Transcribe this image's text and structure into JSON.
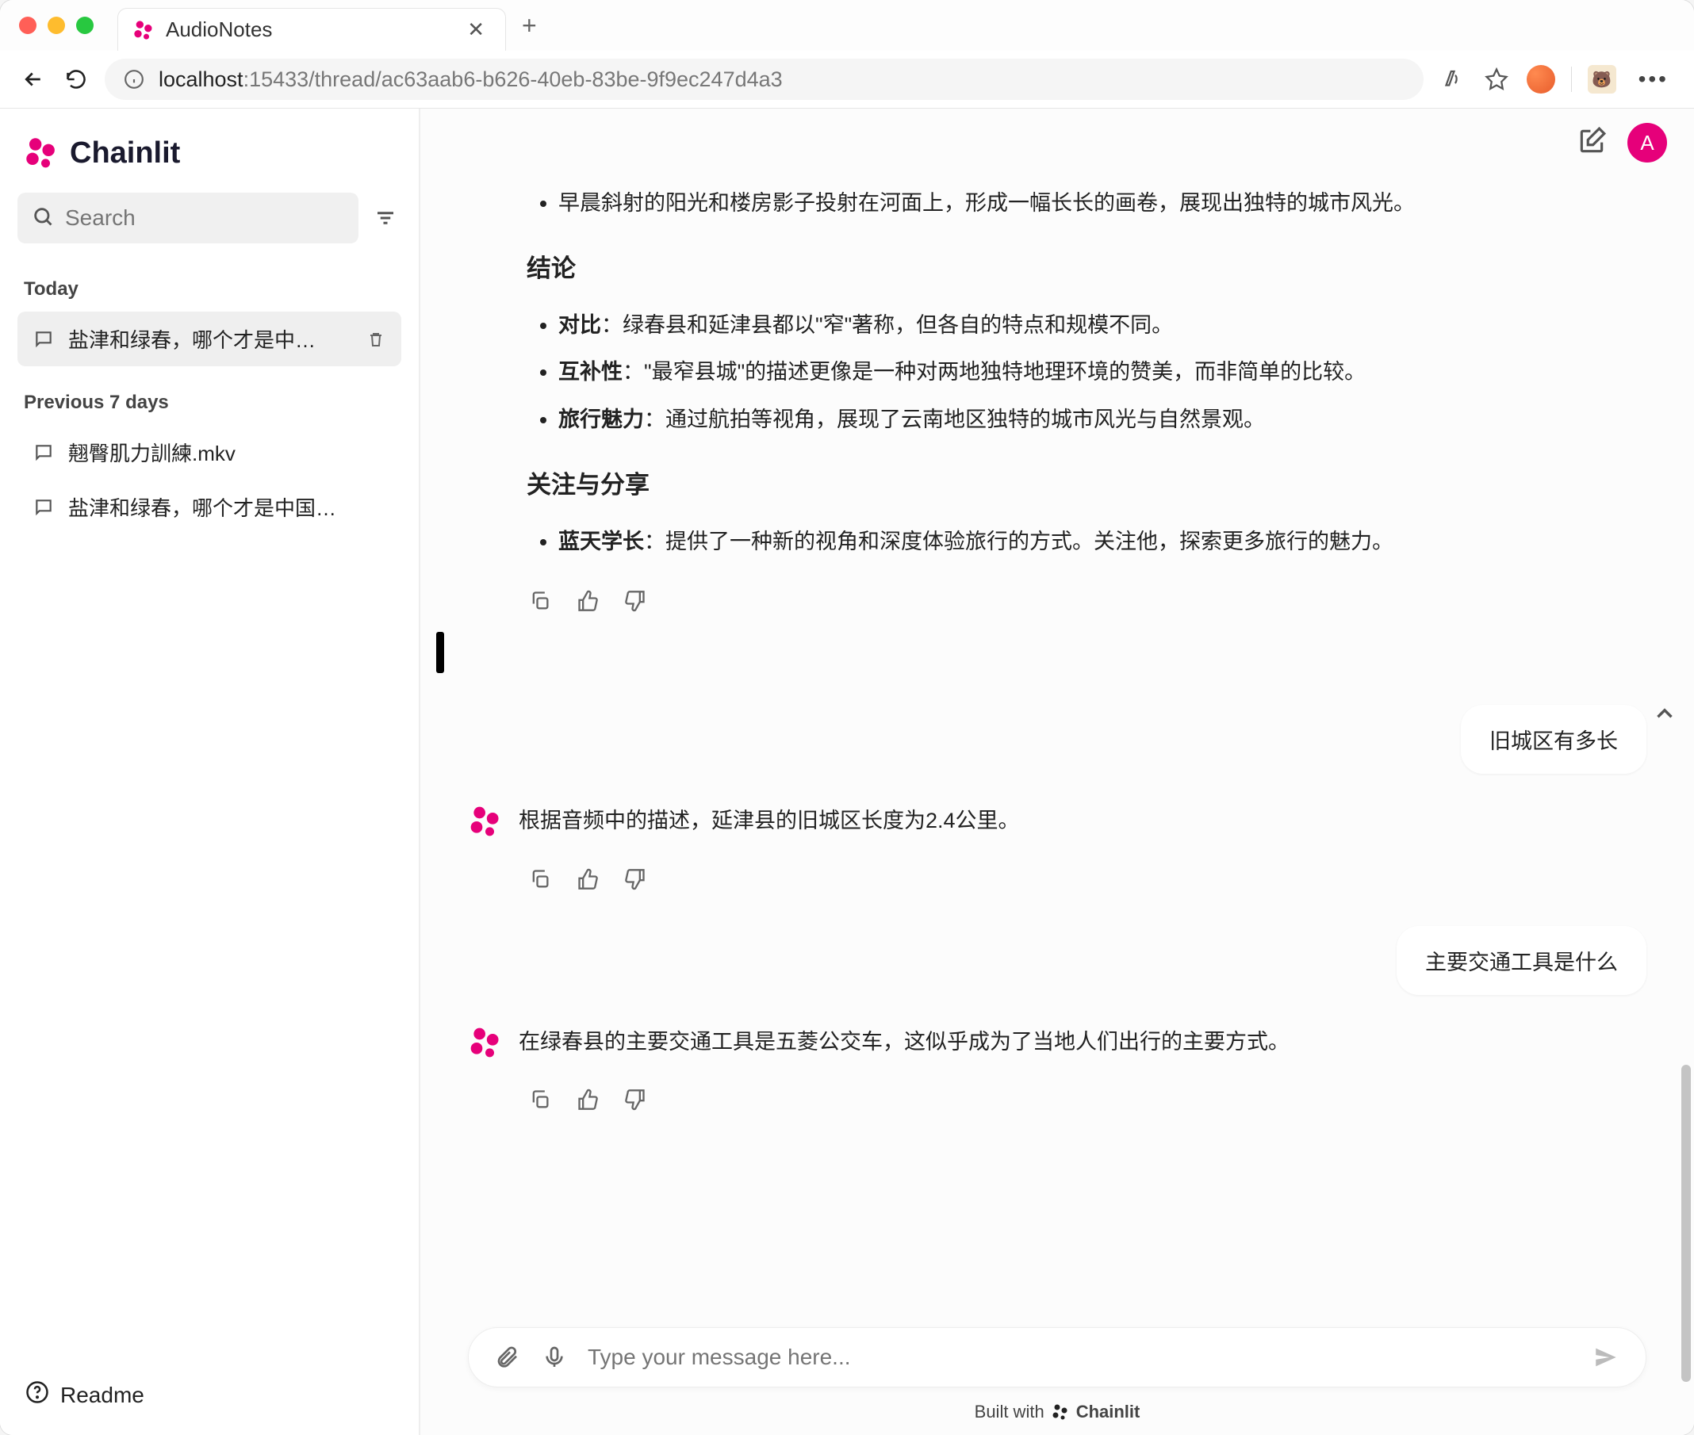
{
  "browser": {
    "tab_title": "AudioNotes",
    "url_host": "localhost",
    "url_path": ":15433/thread/ac63aab6-b626-40eb-83be-9f9ec247d4a3"
  },
  "sidebar": {
    "brand": "Chainlit",
    "search_placeholder": "Search",
    "sections": [
      {
        "label": "Today",
        "items": [
          {
            "title": "盐津和绿春，哪个才是中…",
            "active": true,
            "deletable": true
          }
        ]
      },
      {
        "label": "Previous 7 days",
        "items": [
          {
            "title": "翹臀肌力訓練.mkv",
            "active": false,
            "deletable": false
          },
          {
            "title": "盐津和绿春，哪个才是中国…",
            "active": false,
            "deletable": false
          }
        ]
      }
    ],
    "readme": "Readme"
  },
  "header": {
    "avatar_letter": "A"
  },
  "conversation": {
    "partial_bullet": "早晨斜射的阳光和楼房影子投射在河面上，形成一幅长长的画卷，展现出独特的城市风光。",
    "heading1": "结论",
    "bullets1": [
      {
        "term": "对比",
        "text": "：绿春县和延津县都以\"窄\"著称，但各自的特点和规模不同。"
      },
      {
        "term": "互补性",
        "text": "：\"最窄县城\"的描述更像是一种对两地独特地理环境的赞美，而非简单的比较。"
      },
      {
        "term": "旅行魅力",
        "text": "：通过航拍等视角，展现了云南地区独特的城市风光与自然景观。"
      }
    ],
    "heading2": "关注与分享",
    "bullets2": [
      {
        "term": "蓝天学长",
        "text": "：提供了一种新的视角和深度体验旅行的方式。关注他，探索更多旅行的魅力。"
      }
    ],
    "user1": "旧城区有多长",
    "assistant1": "根据音频中的描述，延津县的旧城区长度为2.4公里。",
    "user2": "主要交通工具是什么",
    "assistant2": "在绿春县的主要交通工具是五菱公交车，这似乎成为了当地人们出行的主要方式。"
  },
  "composer": {
    "placeholder": "Type your message here..."
  },
  "footer": {
    "prefix": "Built with",
    "brand": "Chainlit"
  }
}
